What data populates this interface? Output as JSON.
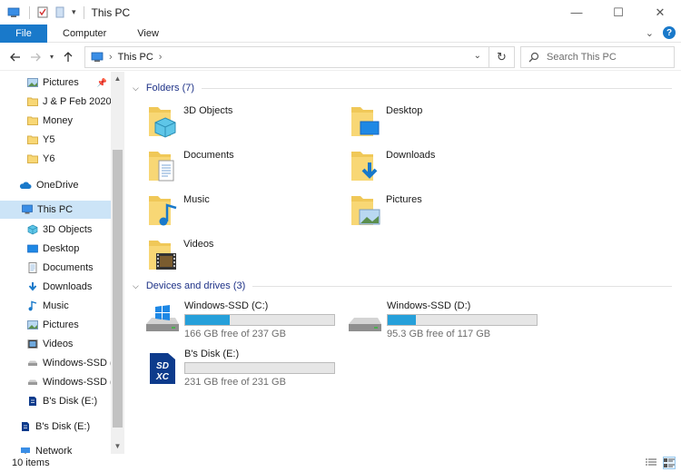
{
  "window": {
    "title": "This PC",
    "minimize_glyph": "—",
    "maximize_glyph": "☐",
    "close_glyph": "✕"
  },
  "ribbon": {
    "tabs": [
      {
        "label": "File"
      },
      {
        "label": "Computer"
      },
      {
        "label": "View"
      }
    ]
  },
  "address": {
    "path": [
      "This PC"
    ],
    "search_placeholder": "Search This PC"
  },
  "nav_pane": {
    "quick_access": [
      {
        "label": "Pictures",
        "icon": "pictures-icon",
        "pinned": true
      },
      {
        "label": "J & P Feb 2020",
        "icon": "folder-icon"
      },
      {
        "label": "Money",
        "icon": "folder-icon"
      },
      {
        "label": "Y5",
        "icon": "folder-icon"
      },
      {
        "label": "Y6",
        "icon": "folder-icon"
      }
    ],
    "onedrive": {
      "label": "OneDrive",
      "icon": "cloud-icon"
    },
    "this_pc": {
      "label": "This PC",
      "icon": "computer-icon",
      "selected": true
    },
    "this_pc_children": [
      {
        "label": "3D Objects",
        "icon": "3d-objects-icon"
      },
      {
        "label": "Desktop",
        "icon": "desktop-icon"
      },
      {
        "label": "Documents",
        "icon": "documents-icon"
      },
      {
        "label": "Downloads",
        "icon": "downloads-icon"
      },
      {
        "label": "Music",
        "icon": "music-icon"
      },
      {
        "label": "Pictures",
        "icon": "pictures-icon"
      },
      {
        "label": "Videos",
        "icon": "videos-icon"
      },
      {
        "label": "Windows-SSD (C",
        "icon": "drive-icon"
      },
      {
        "label": "Windows-SSD (D",
        "icon": "drive-icon"
      },
      {
        "label": "B's Disk (E:)",
        "icon": "sd-card-icon"
      }
    ],
    "b_disk": {
      "label": "B's Disk (E:)",
      "icon": "sd-card-icon"
    },
    "network": {
      "label": "Network",
      "icon": "network-icon"
    }
  },
  "folders_group": {
    "header": "Folders (7)",
    "items": [
      {
        "label": "3D Objects",
        "icon": "3d-objects-folder-icon"
      },
      {
        "label": "Desktop",
        "icon": "desktop-folder-icon"
      },
      {
        "label": "Documents",
        "icon": "documents-folder-icon"
      },
      {
        "label": "Downloads",
        "icon": "downloads-folder-icon"
      },
      {
        "label": "Music",
        "icon": "music-folder-icon"
      },
      {
        "label": "Pictures",
        "icon": "pictures-folder-icon"
      },
      {
        "label": "Videos",
        "icon": "videos-folder-icon"
      }
    ]
  },
  "drives_group": {
    "header": "Devices and drives (3)",
    "items": [
      {
        "name": "Windows-SSD (C:)",
        "free": "166 GB free of 237 GB",
        "used_fraction": 0.3,
        "icon": "windows-drive-icon"
      },
      {
        "name": "Windows-SSD (D:)",
        "free": "95.3 GB free of 117 GB",
        "used_fraction": 0.19,
        "icon": "drive-icon"
      },
      {
        "name": "B's Disk (E:)",
        "free": "231 GB free of 231 GB",
        "used_fraction": 0.0,
        "icon": "sdxc-card-icon"
      }
    ]
  },
  "status": {
    "item_count": "10 items"
  },
  "colors": {
    "accent": "#1979ca",
    "selection": "#cce4f7",
    "bar_fill": "#26a0da",
    "group_header": "#1e3287"
  }
}
